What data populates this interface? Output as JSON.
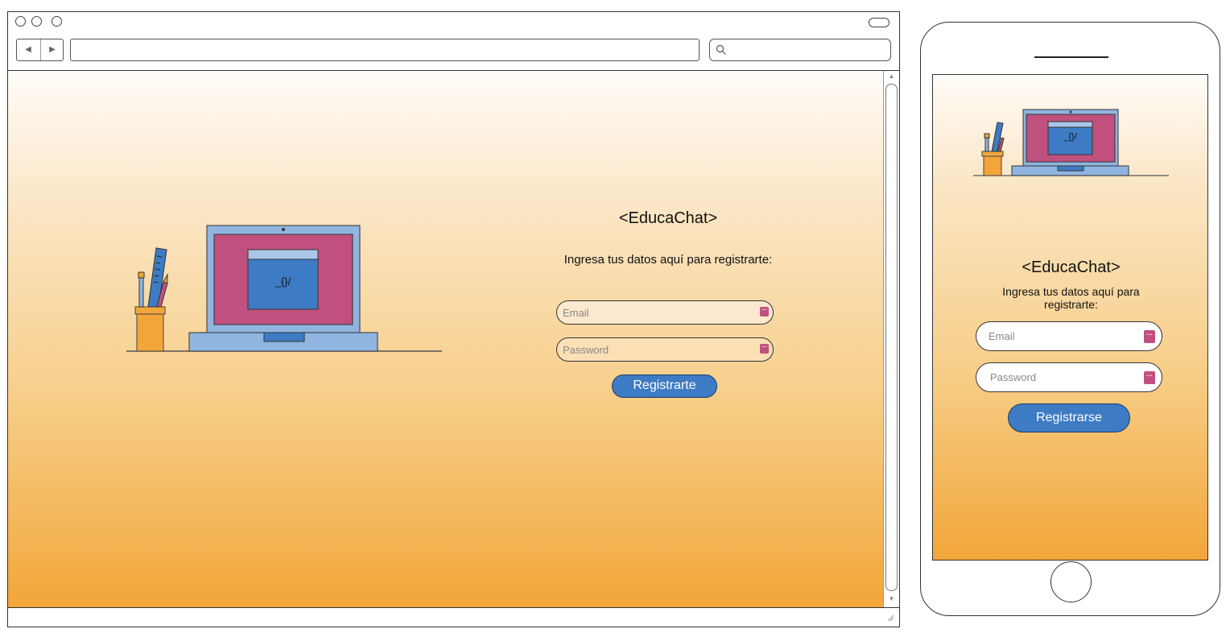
{
  "desktop": {
    "url_value": "",
    "search_value": "",
    "app_title": "<EducaChat>",
    "subtitle": "Ingresa tus datos aquí para registrarte:",
    "email_placeholder": "Email",
    "password_placeholder": "Password",
    "submit_label": "Registrarte",
    "screen_code": "_{}/"
  },
  "mobile": {
    "app_title": "<EducaChat>",
    "subtitle": "Ingresa tus datos aquí para registrarte:",
    "email_placeholder": "Email",
    "password_placeholder": "Password",
    "submit_label": "Registrarse",
    "screen_code": "_{}/"
  },
  "icons": {
    "back": "back-arrow-icon",
    "forward": "forward-arrow-icon",
    "search": "search-icon",
    "password_manager": "password-key-icon"
  },
  "colors": {
    "accent_button": "#3d7cc4",
    "laptop_screen": "#c0507e",
    "laptop_body": "#8fb5e0",
    "gradient_bottom": "#f2a63a",
    "pencil_cup": "#f2a63a"
  }
}
